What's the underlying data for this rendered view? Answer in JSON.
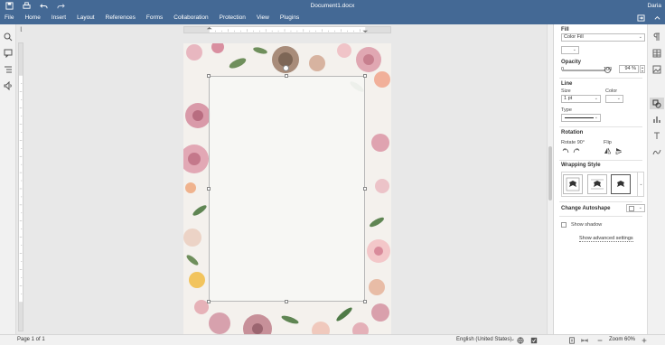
{
  "app": {
    "title": "Document1.docx",
    "user": "Daria"
  },
  "menu": {
    "items": [
      "File",
      "Home",
      "Insert",
      "Layout",
      "References",
      "Forms",
      "Collaboration",
      "Protection",
      "View",
      "Plugins"
    ]
  },
  "panel": {
    "fill": {
      "section": "Fill",
      "type_value": "Color Fill"
    },
    "opacity": {
      "label": "Opacity",
      "min": "0",
      "max": "100",
      "value": "94 %",
      "level": 0.94
    },
    "line": {
      "section": "Line",
      "size_label": "Size",
      "size_value": "1 pt",
      "color_label": "Color",
      "type_label": "Type"
    },
    "rotation": {
      "section": "Rotation",
      "rotate_label": "Rotate 90°",
      "flip_label": "Flip"
    },
    "wrapping": {
      "section": "Wrapping Style"
    },
    "autoshape": {
      "label": "Change Autoshape"
    },
    "shadow": {
      "label": "Show shadow",
      "checked": false
    },
    "advanced": {
      "label": "Show advanced settings"
    }
  },
  "status": {
    "page": "Page 1 of 1",
    "language": "English (United States)",
    "zoom": "Zoom 60%"
  },
  "colors": {
    "brand": "#446995",
    "panel_bg": "#ffffff",
    "workspace_bg": "#e8e8e8"
  },
  "icons": {
    "titlebar": [
      "save-icon",
      "print-icon",
      "undo-icon",
      "redo-icon"
    ],
    "left": [
      "search-icon",
      "comments-icon",
      "navigation-icon",
      "speaker-icon"
    ],
    "right": [
      "paragraph-settings-icon",
      "table-settings-icon",
      "image-settings-icon",
      "shape-settings-icon",
      "chart-settings-icon",
      "text-art-icon",
      "signature-icon"
    ]
  }
}
